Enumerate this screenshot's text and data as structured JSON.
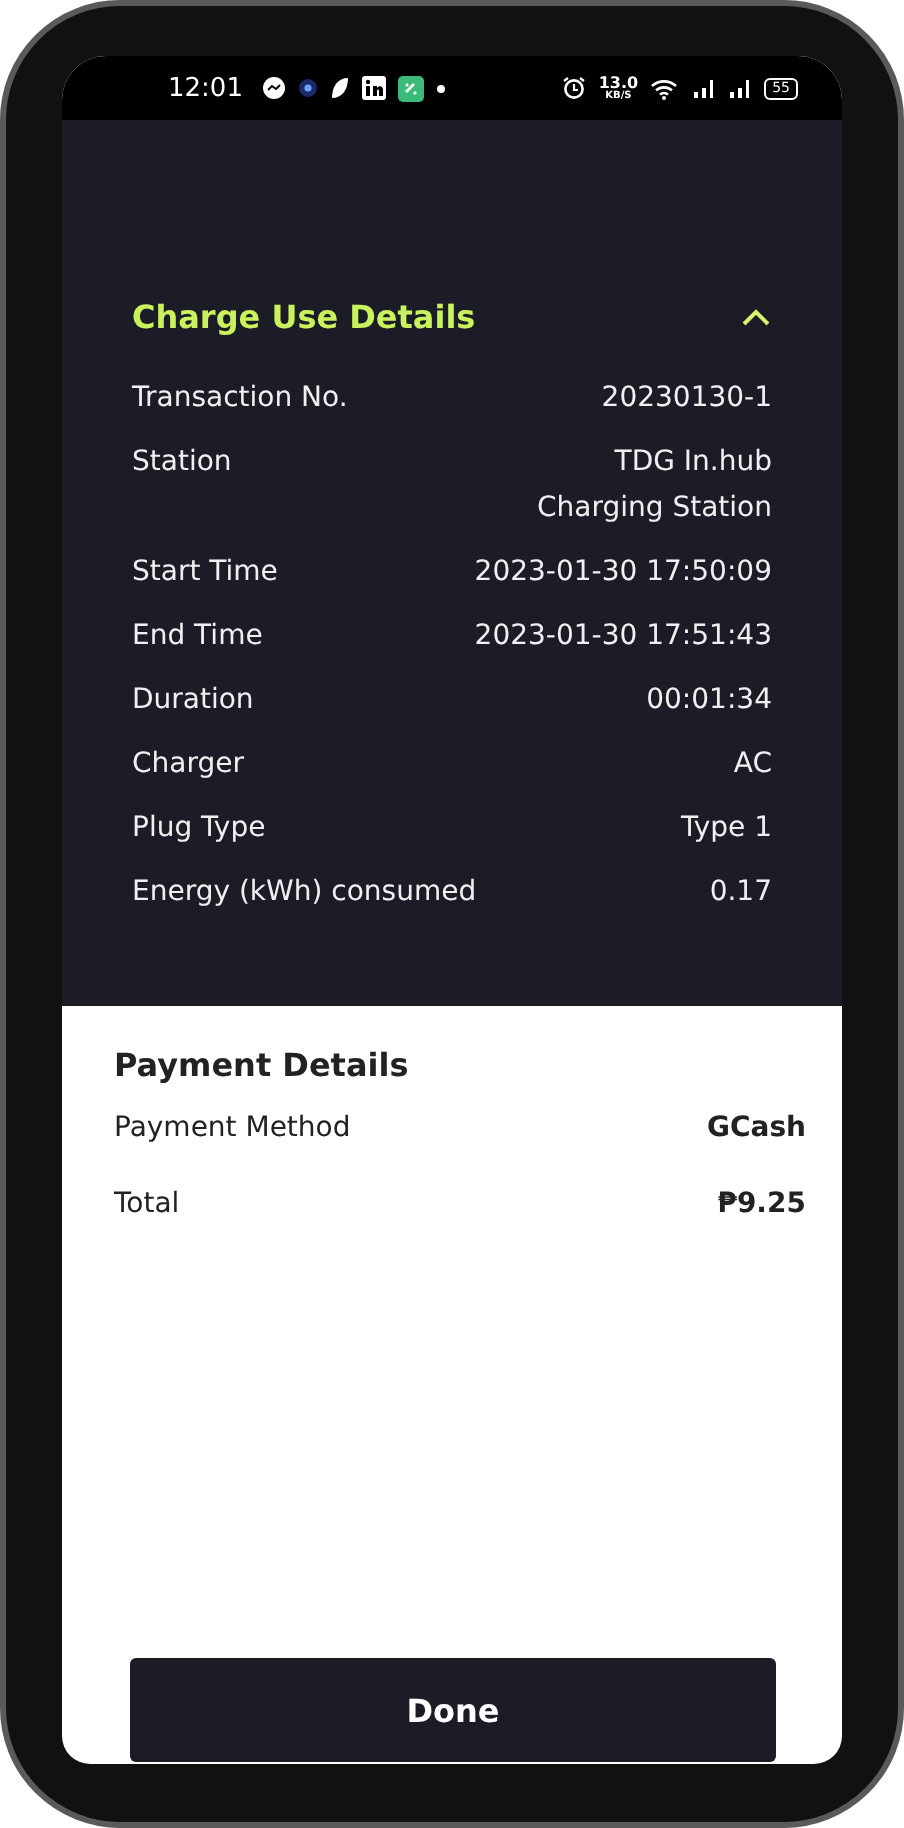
{
  "status_bar": {
    "time": "12:01",
    "speed_value": "13.0",
    "speed_unit": "KB/S",
    "battery": "55"
  },
  "charge_details": {
    "title": "Charge Use Details",
    "expanded": true,
    "rows": [
      {
        "label": "Transaction No.",
        "value": "20230130-1"
      },
      {
        "label": "Station",
        "value": "TDG In.hub\nCharging Station"
      },
      {
        "label": "Start Time",
        "value": "2023-01-30 17:50:09"
      },
      {
        "label": "End Time",
        "value": "2023-01-30 17:51:43"
      },
      {
        "label": "Duration",
        "value": "00:01:34"
      },
      {
        "label": "Charger",
        "value": "AC"
      },
      {
        "label": "Plug Type",
        "value": "Type 1"
      },
      {
        "label": "Energy (kWh) consumed",
        "value": "0.17"
      }
    ]
  },
  "payment_details": {
    "title": "Payment Details",
    "rows": [
      {
        "label": "Payment Method",
        "value": "GCash"
      },
      {
        "label": "Total",
        "value": "₱9.25"
      }
    ]
  },
  "done_button": "Done"
}
